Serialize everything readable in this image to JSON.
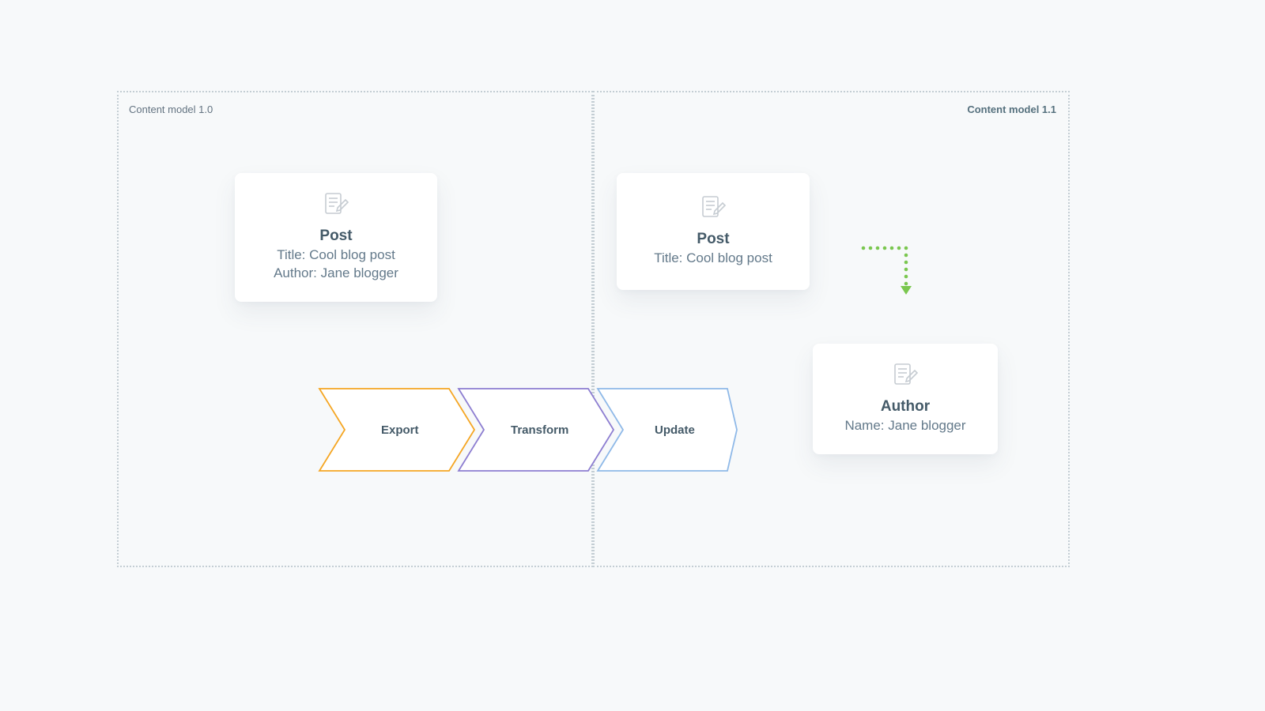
{
  "panels": {
    "left_label": "Content model 1.0",
    "right_label": "Content model 1.1"
  },
  "cards": {
    "post_left": {
      "title": "Post",
      "line1": "Title: Cool blog post",
      "line2": "Author: Jane blogger"
    },
    "post_right": {
      "title": "Post",
      "line1": "Title: Cool blog post"
    },
    "author": {
      "title": "Author",
      "line1": "Name: Jane blogger"
    }
  },
  "pipeline": {
    "step1": "Export",
    "step2": "Transform",
    "step3": "Update"
  },
  "colors": {
    "step1": "#f5a623",
    "step2": "#8d7ed1",
    "step3": "#8fb9e8",
    "arrow": "#7ac74f"
  }
}
